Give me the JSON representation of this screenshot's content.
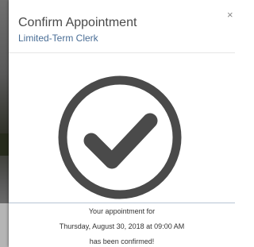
{
  "modal": {
    "title": "Confirm Appointment",
    "subtitle": "Limited-Term Clerk",
    "close_label": "×"
  },
  "confirmation": {
    "icon": "check-circle-icon",
    "icon_color": "#4a4a4a",
    "line1": "Your appointment for",
    "line2": "Thursday, August 30, 2018 at 09:00 AM",
    "line3": "has been confirmed!"
  },
  "colors": {
    "title": "#4a4a4a",
    "subtitle": "#4a6e96",
    "divider": "#b7c4d4"
  }
}
